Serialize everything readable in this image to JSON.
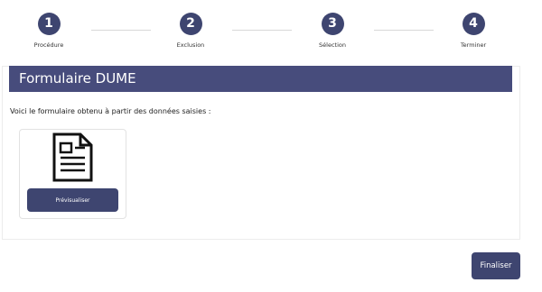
{
  "stepper": {
    "steps": [
      {
        "number": "1",
        "label": "Procédure"
      },
      {
        "number": "2",
        "label": "Exclusion"
      },
      {
        "number": "3",
        "label": "Sélection"
      },
      {
        "number": "4",
        "label": "Terminer"
      }
    ]
  },
  "panel": {
    "title": "Formulaire DUME",
    "intro": "Voici le formulaire obtenu à partir des données saisies :"
  },
  "document_card": {
    "icon": "document-icon",
    "button_label": "Prévisualiser"
  },
  "actions": {
    "finalize_label": "Finaliser"
  },
  "colors": {
    "accent": "#3e4570",
    "header": "#474c7c"
  }
}
